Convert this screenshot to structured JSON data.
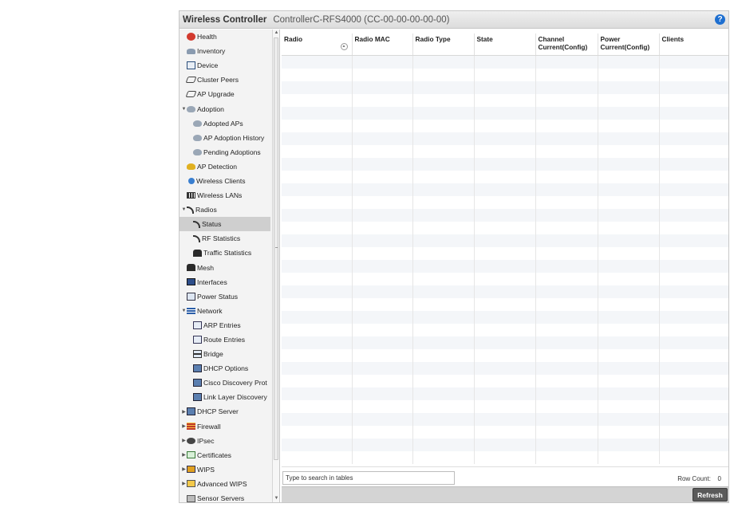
{
  "header": {
    "app_title": "Wireless Controller",
    "controller_title": "ControllerC-RFS4000 (CC-00-00-00-00-00)",
    "help_icon": "question-icon",
    "help_text": "?"
  },
  "sidebar": {
    "items": [
      {
        "label": "Health",
        "icon": "health-icon",
        "ico": "health",
        "indent": 1
      },
      {
        "label": "Inventory",
        "icon": "inventory-icon",
        "ico": "inventory",
        "indent": 1
      },
      {
        "label": "Device",
        "icon": "device-icon",
        "ico": "device",
        "indent": 1
      },
      {
        "label": "Cluster Peers",
        "icon": "cluster-peers-icon",
        "ico": "peers",
        "indent": 1
      },
      {
        "label": "AP Upgrade",
        "icon": "ap-upgrade-icon",
        "ico": "peers",
        "indent": 1
      },
      {
        "label": "Adoption",
        "icon": "adoption-icon",
        "ico": "adopt",
        "indent": 0,
        "expand": "expanded"
      },
      {
        "label": "Adopted APs",
        "icon": "adopted-aps-icon",
        "ico": "adopt",
        "indent": 2
      },
      {
        "label": "AP Adoption History",
        "icon": "adoption-history-icon",
        "ico": "adopt",
        "indent": 2
      },
      {
        "label": "Pending Adoptions",
        "icon": "pending-adoptions-icon",
        "ico": "adopt",
        "indent": 2
      },
      {
        "label": "AP Detection",
        "icon": "ap-detection-icon",
        "ico": "apdet",
        "indent": 1
      },
      {
        "label": "Wireless Clients",
        "icon": "wireless-clients-icon",
        "ico": "clients",
        "indent": 1
      },
      {
        "label": "Wireless LANs",
        "icon": "wireless-lans-icon",
        "ico": "wlan",
        "indent": 1
      },
      {
        "label": "Radios",
        "icon": "radios-icon",
        "ico": "radio",
        "indent": 0,
        "expand": "expanded"
      },
      {
        "label": "Status",
        "icon": "radio-status-icon",
        "ico": "radio",
        "indent": 2,
        "selected": true
      },
      {
        "label": "RF Statistics",
        "icon": "rf-statistics-icon",
        "ico": "radio",
        "indent": 2
      },
      {
        "label": "Traffic Statistics",
        "icon": "traffic-statistics-icon",
        "ico": "traffic",
        "indent": 2
      },
      {
        "label": "Mesh",
        "icon": "mesh-icon",
        "ico": "traffic",
        "indent": 1
      },
      {
        "label": "Interfaces",
        "icon": "interfaces-icon",
        "ico": "iface",
        "indent": 1
      },
      {
        "label": "Power Status",
        "icon": "power-status-icon",
        "ico": "power",
        "indent": 1
      },
      {
        "label": "Network",
        "icon": "network-icon",
        "ico": "network",
        "indent": 0,
        "expand": "expanded"
      },
      {
        "label": "ARP Entries",
        "icon": "arp-entries-icon",
        "ico": "arp",
        "indent": 2
      },
      {
        "label": "Route Entries",
        "icon": "route-entries-icon",
        "ico": "arp",
        "indent": 2
      },
      {
        "label": "Bridge",
        "icon": "bridge-icon",
        "ico": "bridge",
        "indent": 2
      },
      {
        "label": "DHCP Options",
        "icon": "dhcp-options-icon",
        "ico": "dhcp",
        "indent": 2
      },
      {
        "label": "Cisco Discovery Prot",
        "icon": "cisco-discovery-icon",
        "ico": "dhcp",
        "indent": 2
      },
      {
        "label": "Link Layer Discovery",
        "icon": "link-layer-discovery-icon",
        "ico": "dhcp",
        "indent": 2
      },
      {
        "label": "DHCP Server",
        "icon": "dhcp-server-icon",
        "ico": "dhcp",
        "indent": 0,
        "expand": "collapsed"
      },
      {
        "label": "Firewall",
        "icon": "firewall-icon",
        "ico": "firewall",
        "indent": 0,
        "expand": "collapsed"
      },
      {
        "label": "IPsec",
        "icon": "ipsec-icon",
        "ico": "ipsec",
        "indent": 0,
        "expand": "collapsed"
      },
      {
        "label": "Certificates",
        "icon": "certificates-icon",
        "ico": "cert",
        "indent": 0,
        "expand": "collapsed"
      },
      {
        "label": "WIPS",
        "icon": "wips-icon",
        "ico": "wips",
        "indent": 0,
        "expand": "collapsed"
      },
      {
        "label": "Advanced WIPS",
        "icon": "advanced-wips-icon",
        "ico": "adwips",
        "indent": 0,
        "expand": "collapsed"
      },
      {
        "label": "Sensor Servers",
        "icon": "sensor-servers-icon",
        "ico": "sensor",
        "indent": 1
      }
    ],
    "scroll_up_icon": "scroll-up-arrow-icon",
    "scroll_down_icon": "scroll-down-arrow-icon"
  },
  "table": {
    "columns": [
      {
        "label": "Radio",
        "sort_icon": "sort-ascending-icon"
      },
      {
        "label": "Radio MAC"
      },
      {
        "label": "Radio Type"
      },
      {
        "label": "State"
      },
      {
        "label": "Channel Current(Config)"
      },
      {
        "label": "Power Current(Config)"
      },
      {
        "label": "Clients"
      }
    ],
    "rows": []
  },
  "footer": {
    "search_placeholder": "Type to search in tables",
    "search_value": "",
    "row_count_label": "Row Count:",
    "row_count_value": "0"
  },
  "actions": {
    "refresh_label": "Refresh"
  }
}
